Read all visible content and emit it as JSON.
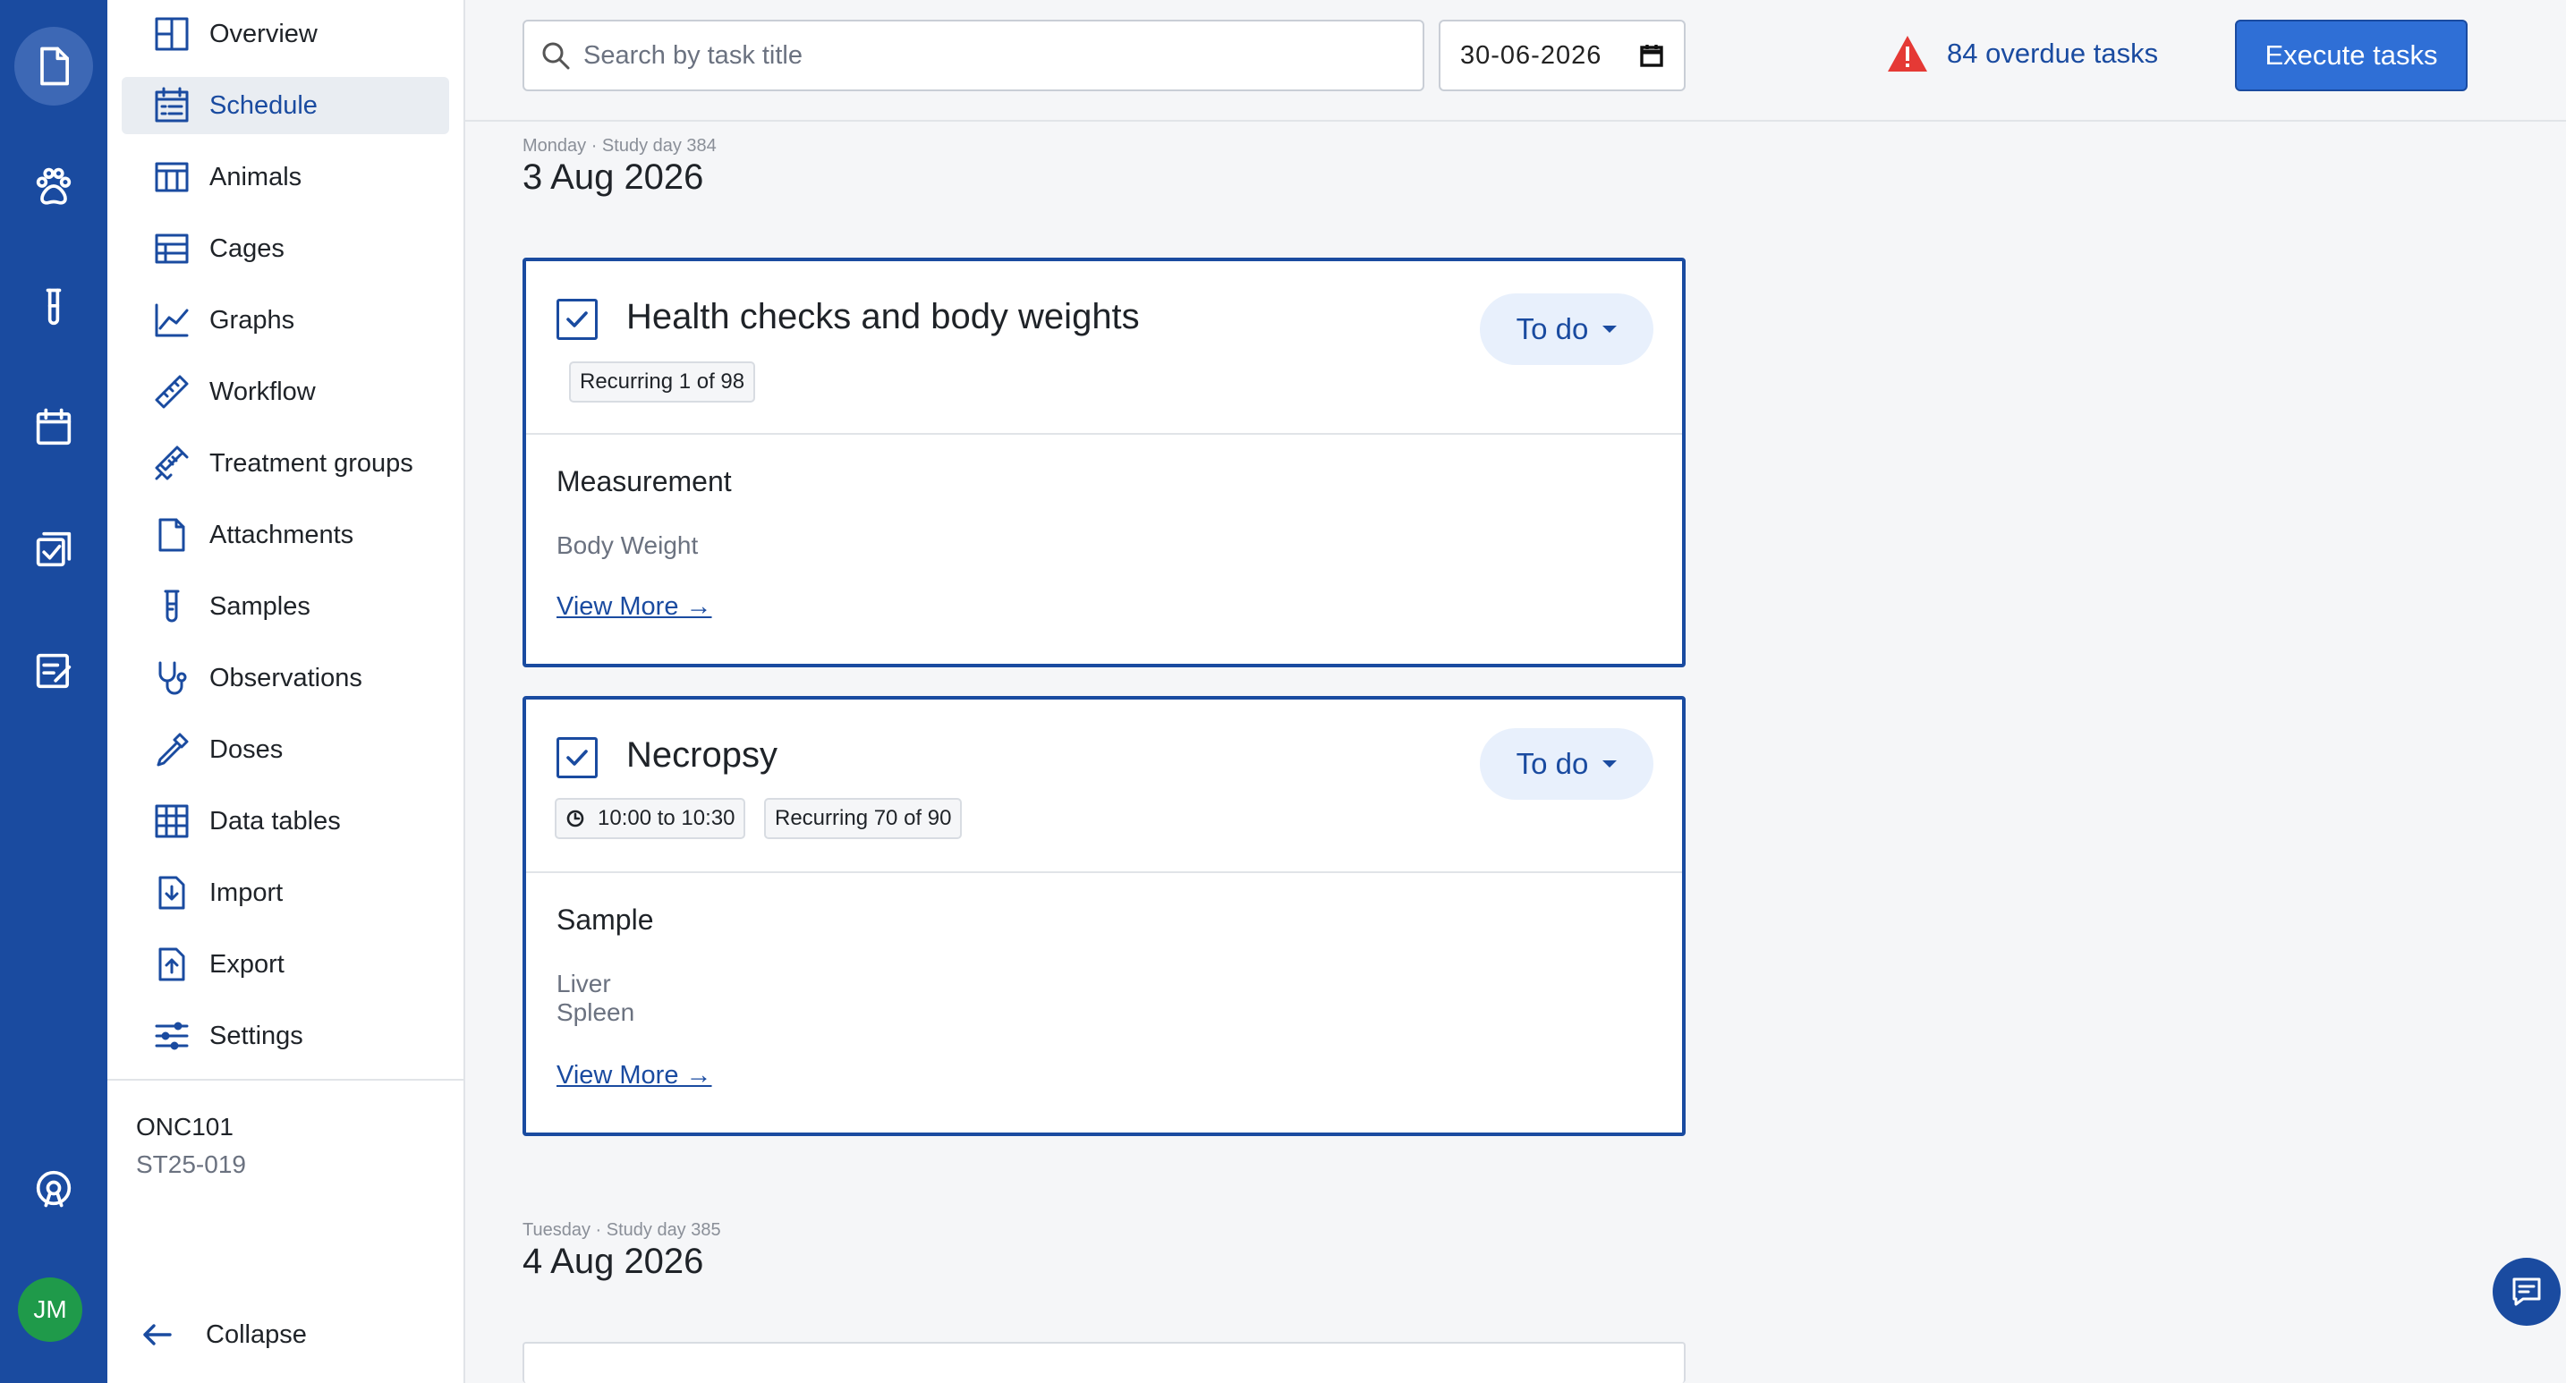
{
  "rail": {
    "icons": [
      "document-icon",
      "paw-icon",
      "test-tube-icon",
      "calendar-icon",
      "tasks-icon",
      "form-icon",
      "support-icon"
    ],
    "avatar_initials": "JM"
  },
  "nav": {
    "items": [
      {
        "label": "Overview",
        "icon": "overview-icon"
      },
      {
        "label": "Schedule",
        "icon": "schedule-icon"
      },
      {
        "label": "Animals",
        "icon": "table-icon"
      },
      {
        "label": "Cages",
        "icon": "cages-icon"
      },
      {
        "label": "Graphs",
        "icon": "graph-icon"
      },
      {
        "label": "Workflow",
        "icon": "ruler-icon"
      },
      {
        "label": "Treatment groups",
        "icon": "syringe-icon"
      },
      {
        "label": "Attachments",
        "icon": "file-icon"
      },
      {
        "label": "Samples",
        "icon": "test-tube-icon"
      },
      {
        "label": "Observations",
        "icon": "stethoscope-icon"
      },
      {
        "label": "Doses",
        "icon": "dropper-icon"
      },
      {
        "label": "Data tables",
        "icon": "grid-icon"
      },
      {
        "label": "Import",
        "icon": "import-icon"
      },
      {
        "label": "Export",
        "icon": "export-icon"
      },
      {
        "label": "Settings",
        "icon": "sliders-icon"
      }
    ],
    "active_item": "Schedule",
    "study_code": "ONC101",
    "study_id": "ST25-019",
    "collapse_label": "Collapse"
  },
  "topbar": {
    "search_placeholder": "Search by task title",
    "date_value": "30-06-2026",
    "overdue_text": "84 overdue tasks",
    "execute_label": "Execute tasks"
  },
  "days": [
    {
      "meta": "Monday · Study day 384",
      "date": "3 Aug 2026",
      "tasks": [
        {
          "title": "Health checks and body weights",
          "status": "To do",
          "tags": [
            "Recurring 1 of 98"
          ],
          "section": "Measurement",
          "items": [
            "Body Weight"
          ],
          "link": "View More →"
        },
        {
          "title": "Necropsy",
          "status": "To do",
          "time": "10:00 to 10:30",
          "tags": [
            "Recurring 70 of 90"
          ],
          "section": "Sample",
          "items": [
            "Liver",
            "Spleen"
          ],
          "link": "View More →"
        }
      ]
    },
    {
      "meta": "Tuesday · Study day 385",
      "date": "4 Aug 2026"
    }
  ],
  "colors": {
    "primary": "#1a4ba0",
    "button": "#2f6fd6",
    "warning": "#e53935",
    "avatar": "#1f9a4a"
  }
}
